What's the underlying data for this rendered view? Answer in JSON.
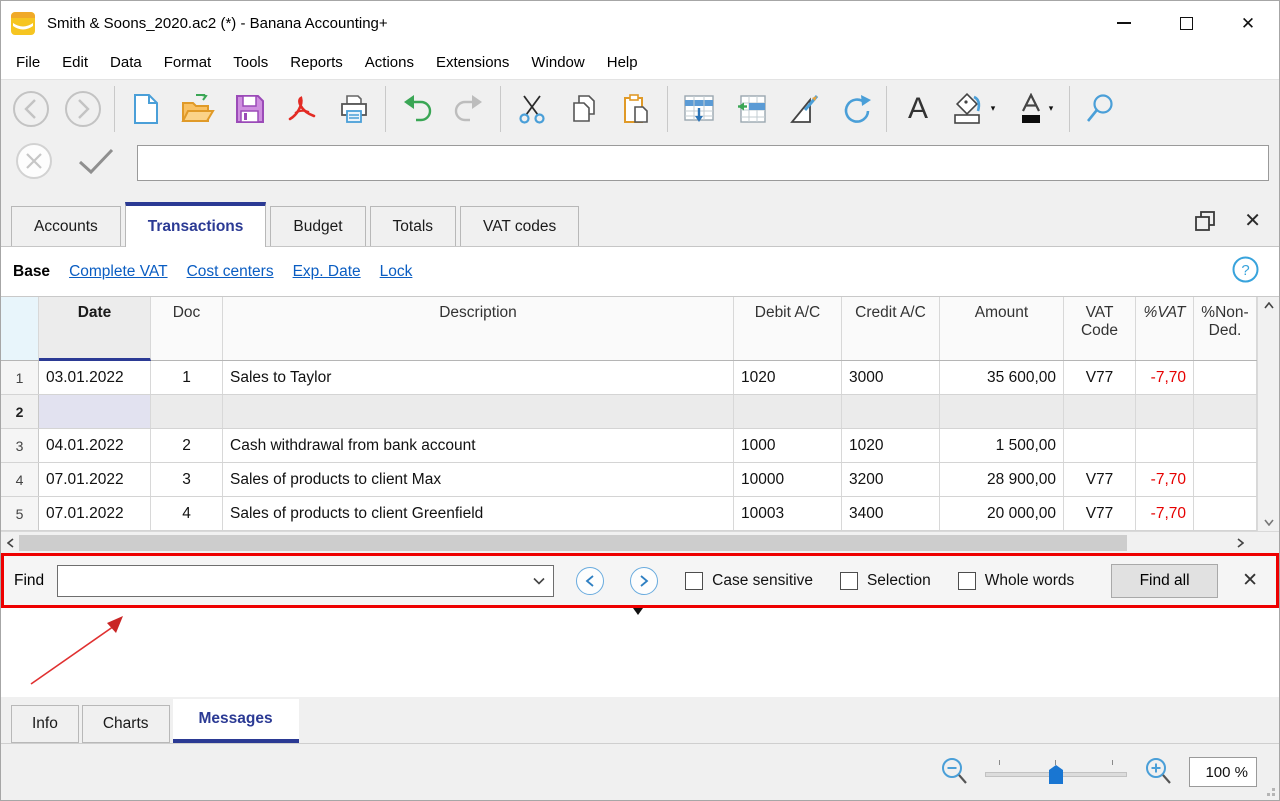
{
  "window": {
    "title": "Smith & Soons_2020.ac2 (*) - Banana Accounting+"
  },
  "menu": {
    "items": [
      "File",
      "Edit",
      "Data",
      "Format",
      "Tools",
      "Reports",
      "Actions",
      "Extensions",
      "Window",
      "Help"
    ]
  },
  "toolbar": {
    "icons": [
      "back",
      "forward",
      "new-file",
      "open-file",
      "save",
      "pdf-export",
      "print",
      "undo",
      "redo",
      "cut",
      "copy",
      "paste",
      "insert-row",
      "insert-cell",
      "design",
      "recalculate",
      "font",
      "fill-color",
      "font-color",
      "search"
    ]
  },
  "tabs": {
    "active": "Transactions",
    "items": [
      "Accounts",
      "Transactions",
      "Budget",
      "Totals",
      "VAT codes"
    ]
  },
  "views": {
    "active": "Base",
    "items": [
      "Base",
      "Complete VAT",
      "Cost centers",
      "Exp. Date",
      "Lock"
    ]
  },
  "table": {
    "columns": [
      "Date",
      "Doc",
      "Description",
      "Debit A/C",
      "Credit A/C",
      "Amount",
      "VAT Code",
      "%VAT",
      "%Non-Ded."
    ],
    "rows": [
      {
        "num": "1",
        "date": "03.01.2022",
        "doc": "1",
        "description": "Sales to Taylor",
        "debit": "1020",
        "credit": "3000",
        "amount": "35 600,00",
        "vat": "V77",
        "pvat": "-7,70",
        "pnon": ""
      },
      {
        "num": "2",
        "date": "",
        "doc": "",
        "description": "",
        "debit": "",
        "credit": "",
        "amount": "",
        "vat": "",
        "pvat": "",
        "pnon": ""
      },
      {
        "num": "3",
        "date": "04.01.2022",
        "doc": "2",
        "description": "Cash withdrawal from bank account",
        "debit": "1000",
        "credit": "1020",
        "amount": "1 500,00",
        "vat": "",
        "pvat": "",
        "pnon": ""
      },
      {
        "num": "4",
        "date": "07.01.2022",
        "doc": "3",
        "description": "Sales of products to client Max",
        "debit": "10000",
        "credit": "3200",
        "amount": "28 900,00",
        "vat": "V77",
        "pvat": "-7,70",
        "pnon": ""
      },
      {
        "num": "5",
        "date": "07.01.2022",
        "doc": "4",
        "description": "Sales of products to client Greenfield",
        "debit": "10003",
        "credit": "3400",
        "amount": "20 000,00",
        "vat": "V77",
        "pvat": "-7,70",
        "pnon": ""
      }
    ]
  },
  "find_bar": {
    "label": "Find",
    "input_value": "",
    "checkboxes": [
      "Case sensitive",
      "Selection",
      "Whole words"
    ],
    "find_all_label": "Find all"
  },
  "bottom_tabs": {
    "active": "Messages",
    "items": [
      "Info",
      "Charts",
      "Messages"
    ]
  },
  "status_bar": {
    "zoom_level": "100 %"
  },
  "colors": {
    "accent_navy": "#2b3a94",
    "link_blue": "#0a5dc2",
    "annotation_red": "#ee0000",
    "negative_red": "#e60000",
    "selected_cell": "#e2e2f0"
  }
}
